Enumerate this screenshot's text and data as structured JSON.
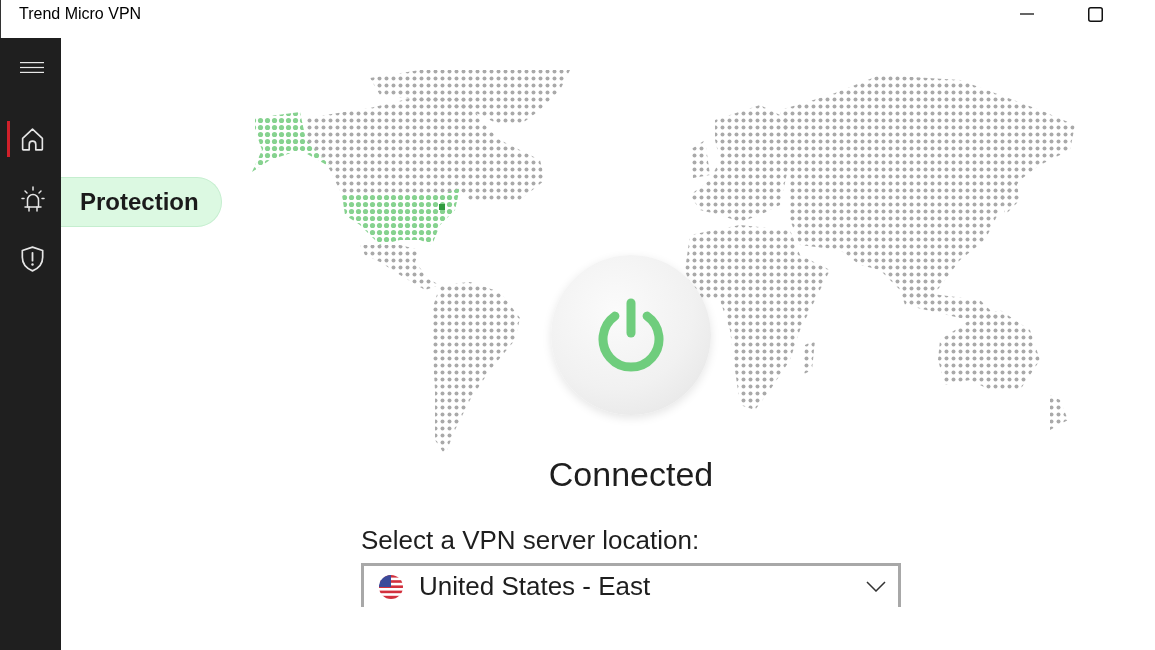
{
  "window": {
    "title": "Trend Micro VPN"
  },
  "sidebar": {
    "items": [
      {
        "kind": "home",
        "selected": true
      },
      {
        "kind": "alert",
        "selected": false
      },
      {
        "kind": "shield",
        "selected": false
      }
    ]
  },
  "notification": {
    "text": "Protection"
  },
  "connection": {
    "status": "Connected",
    "connected": true
  },
  "location": {
    "label": "Select a VPN server location:",
    "value": "United States - East"
  }
}
